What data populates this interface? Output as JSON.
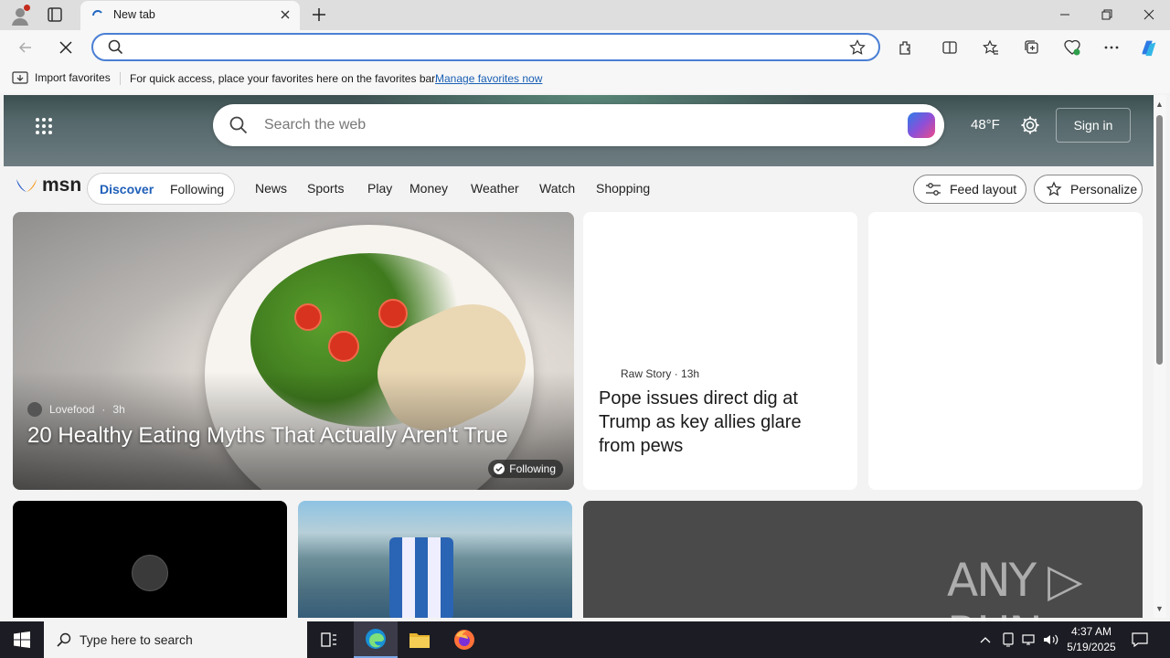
{
  "browser": {
    "tab_title": "New tab",
    "address_value": "",
    "favorites_bar": {
      "import_label": "Import favorites",
      "message": "For quick access, place your favorites here on the favorites bar.",
      "manage_link": "Manage favorites now"
    }
  },
  "page": {
    "search_placeholder": "Search the web",
    "weather": "48°F",
    "signin_label": "Sign in",
    "logo_text": "msn",
    "feed_tabs": [
      "Discover",
      "Following"
    ],
    "categories": [
      "News",
      "Sports",
      "Play",
      "Money",
      "Weather",
      "Watch",
      "Shopping"
    ],
    "feed_layout_label": "Feed layout",
    "personalize_label": "Personalize",
    "big_card": {
      "source": "Lovefood",
      "age": "3h",
      "title": "20 Healthy Eating Myths That Actually Aren't True",
      "following_badge": "Following"
    },
    "story_card": {
      "source": "Raw Story",
      "age": "13h",
      "headline": "Pope issues direct dig at Trump as key allies glare from pews"
    },
    "watermark": "ANY ▷ RUN"
  },
  "taskbar": {
    "search_placeholder": "Type here to search",
    "time": "4:37 AM",
    "date": "5/19/2025"
  },
  "colors": {
    "accent": "#1f5fb8",
    "omnibox_border": "#4a7fd4",
    "taskbar": "#1c1c24"
  }
}
